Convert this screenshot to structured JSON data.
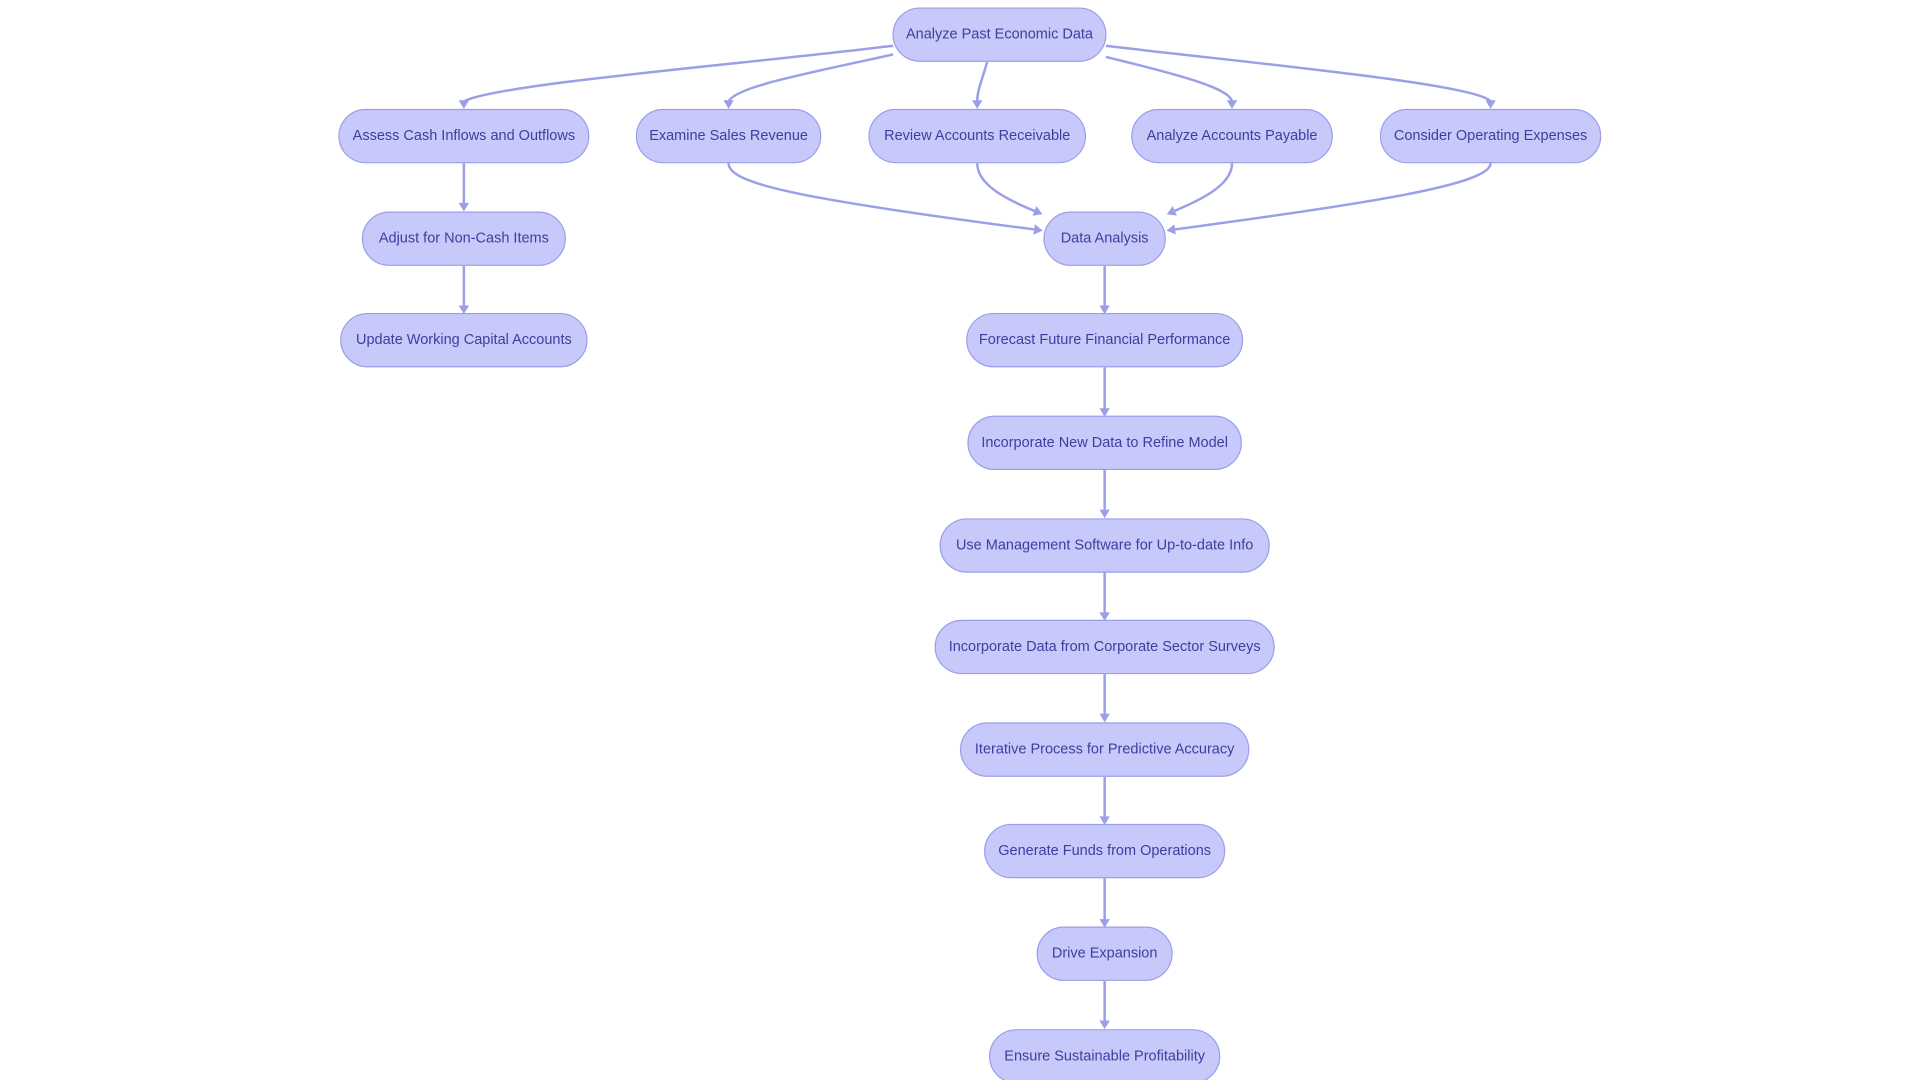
{
  "diagram": {
    "type": "flowchart",
    "colors": {
      "node_fill": "#c7c9fa",
      "node_border": "#9a9ee8",
      "text": "#3c3f9e",
      "edge": "#9b9fe6",
      "background": "#ffffff"
    },
    "nodes": [
      {
        "id": "A",
        "label": "Analyze Past Economic Data"
      },
      {
        "id": "B",
        "label": "Assess Cash Inflows and Outflows"
      },
      {
        "id": "C",
        "label": "Examine Sales Revenue"
      },
      {
        "id": "D",
        "label": "Review Accounts Receivable"
      },
      {
        "id": "E",
        "label": "Analyze Accounts Payable"
      },
      {
        "id": "F",
        "label": "Consider Operating Expenses"
      },
      {
        "id": "G",
        "label": "Adjust for Non-Cash Items"
      },
      {
        "id": "H",
        "label": "Update Working Capital Accounts"
      },
      {
        "id": "I",
        "label": "Data Analysis"
      },
      {
        "id": "J",
        "label": "Forecast Future Financial Performance"
      },
      {
        "id": "K",
        "label": "Incorporate New Data to Refine Model"
      },
      {
        "id": "L",
        "label": "Use Management Software for Up-to-date Info"
      },
      {
        "id": "M",
        "label": "Incorporate Data from Corporate Sector Surveys"
      },
      {
        "id": "N",
        "label": "Iterative Process for Predictive Accuracy"
      },
      {
        "id": "O",
        "label": "Generate Funds from Operations"
      },
      {
        "id": "P",
        "label": "Drive Expansion"
      },
      {
        "id": "Q",
        "label": "Ensure Sustainable Profitability"
      }
    ],
    "edges": [
      {
        "from": "A",
        "to": "B"
      },
      {
        "from": "A",
        "to": "C"
      },
      {
        "from": "A",
        "to": "D"
      },
      {
        "from": "A",
        "to": "E"
      },
      {
        "from": "A",
        "to": "F"
      },
      {
        "from": "B",
        "to": "G"
      },
      {
        "from": "G",
        "to": "H"
      },
      {
        "from": "C",
        "to": "I"
      },
      {
        "from": "D",
        "to": "I"
      },
      {
        "from": "E",
        "to": "I"
      },
      {
        "from": "F",
        "to": "I"
      },
      {
        "from": "I",
        "to": "J"
      },
      {
        "from": "J",
        "to": "K"
      },
      {
        "from": "K",
        "to": "L"
      },
      {
        "from": "L",
        "to": "M"
      },
      {
        "from": "M",
        "to": "N"
      },
      {
        "from": "N",
        "to": "O"
      },
      {
        "from": "O",
        "to": "P"
      },
      {
        "from": "P",
        "to": "Q"
      }
    ]
  }
}
